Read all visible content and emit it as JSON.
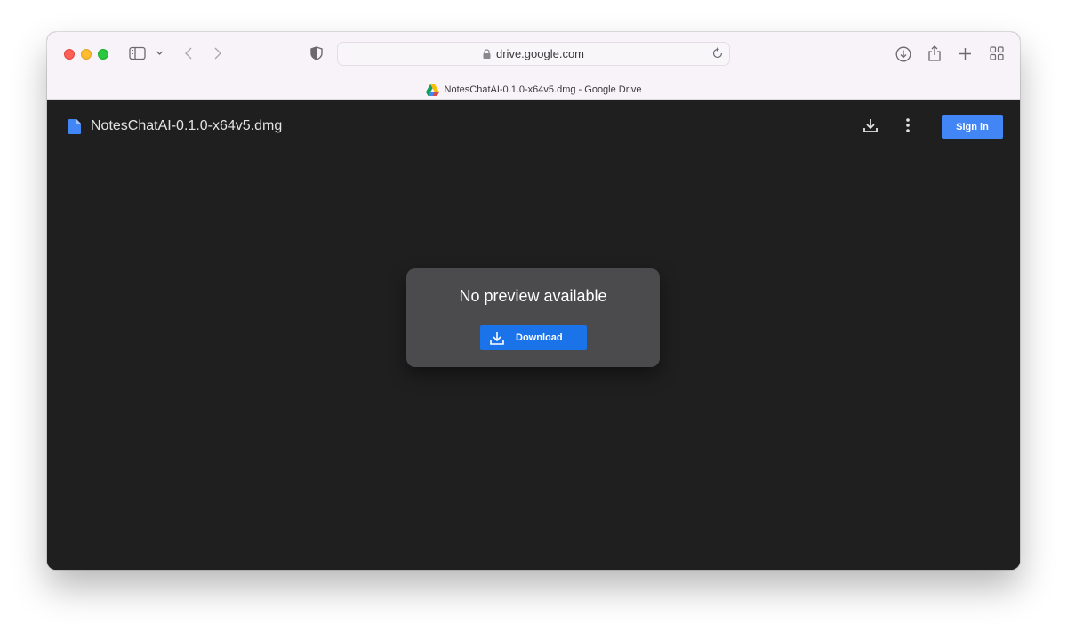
{
  "browser": {
    "url": "drive.google.com",
    "tab_title": "NotesChatAI-0.1.0-x64v5.dmg - Google Drive",
    "icons": {
      "sidebar": "sidebar-toggle-icon",
      "sidebar_menu": "chevron-down-icon",
      "back": "chevron-left-icon",
      "forward": "chevron-right-icon",
      "privacy": "shield-icon",
      "lock": "lock-icon",
      "reload": "reload-icon",
      "downloads": "download-circle-icon",
      "share": "share-icon",
      "new_tab": "plus-icon",
      "tab_overview": "grid-icon"
    }
  },
  "drive": {
    "file_name": "NotesChatAI-0.1.0-x64v5.dmg",
    "sign_in_label": "Sign in",
    "preview": {
      "message": "No preview available",
      "download_label": "Download"
    },
    "colors": {
      "background": "#1f1f1f",
      "card": "#4b4a4d",
      "primary_button": "#1a73e8",
      "sign_in_button": "#4285f4",
      "file_icon": "#4285f4"
    }
  }
}
